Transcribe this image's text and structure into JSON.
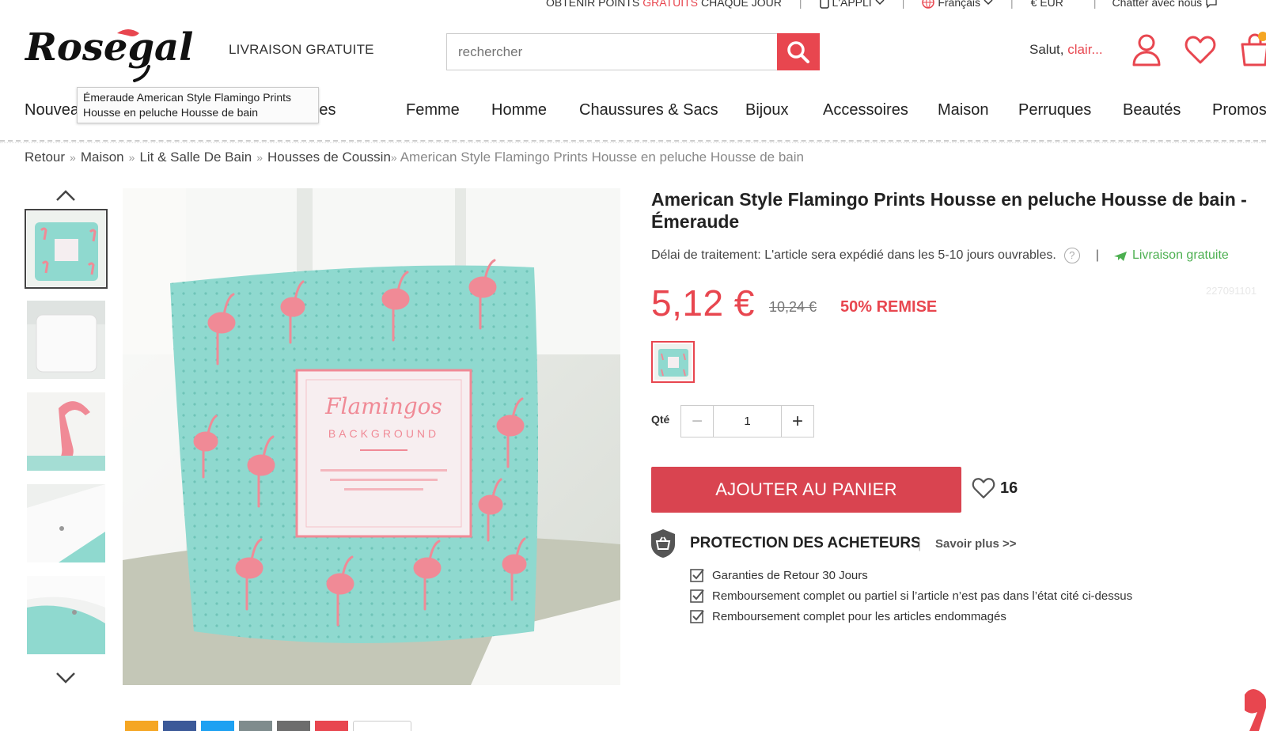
{
  "topbar": {
    "points_prefix": "OBTENIR POINTS",
    "points_accent": "GRATUITS",
    "points_suffix": "CHAQUE JOUR",
    "app": "L'APPLI",
    "language": "Français",
    "currency": "€ EUR",
    "chat": "Chatter avec nous"
  },
  "header": {
    "logo_text": "Rosegal",
    "free_shipping": "LIVRAISON GRATUITE",
    "search_placeholder": "rechercher",
    "greeting": "Salut, ",
    "user_name": "clair..."
  },
  "nav": {
    "items": [
      "Nouveau",
      "Grandes Tailles",
      "Femme",
      "Homme",
      "Chaussures & Sacs",
      "Bijoux",
      "Accessoires",
      "Maison",
      "Perruques",
      "Beautés",
      "Promos"
    ]
  },
  "tooltip": {
    "line1": "Émeraude American Style Flamingo Prints",
    "line2": "Housse en peluche Housse de bain"
  },
  "breadcrumb": {
    "items": [
      "Retour",
      "Maison",
      "Lit & Salle De Bain",
      "Housses de Coussin"
    ],
    "current": "American Style Flamingo Prints Housse en peluche Housse de bain"
  },
  "product": {
    "title": "American Style Flamingo Prints Housse en peluche Housse de bain - Émeraude",
    "delay_label": "Délai de traitement:",
    "delay_text": "L'article sera expédié dans les 5-10 jours ouvrables.",
    "free_delivery": "Livraison gratuite",
    "sku": "227091101",
    "price": "5,12 €",
    "old_price": "10,24 €",
    "discount": "50% REMISE",
    "qty_label": "Qté",
    "qty_value": "1",
    "add_to_cart": "AJOUTER AU PANIER",
    "wish_count": "16",
    "pillow_title": "Flamingos",
    "pillow_sub": "BACKGROUND"
  },
  "protection": {
    "title": "PROTECTION DES ACHETEURS",
    "learn_more": "Savoir plus >>",
    "items": [
      "Garanties de Retour 30 Jours",
      "Remboursement complet ou partiel si l’article n’est pas dans l’état cité ci-dessus",
      "Remboursement complet pour les articles endommagés"
    ]
  },
  "colors": {
    "accent": "#e8464f",
    "mint": "#8fd9cf",
    "flamingo": "#f08a96",
    "green": "#4caf50"
  }
}
